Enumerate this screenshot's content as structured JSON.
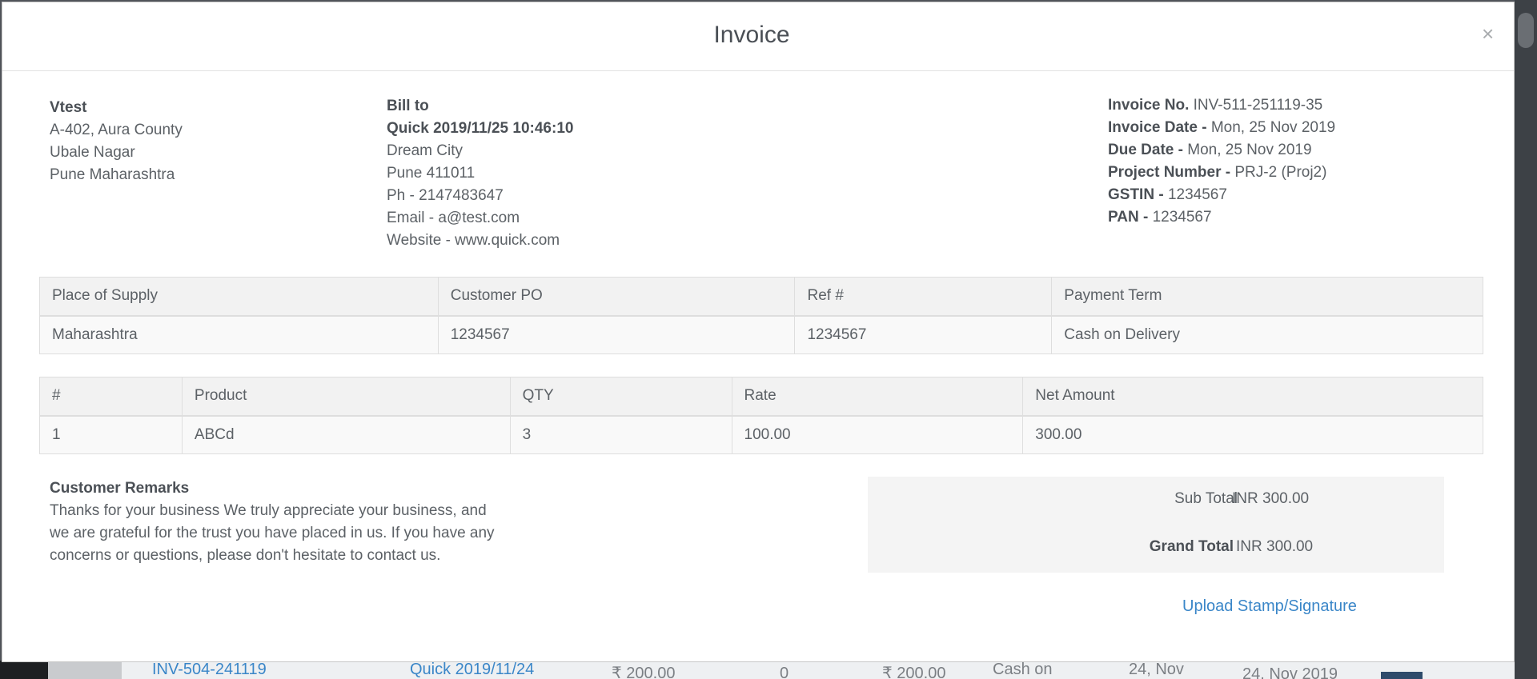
{
  "modal": {
    "title": "Invoice",
    "close": "×"
  },
  "seller": {
    "name": "Vtest",
    "address_lines": [
      "A-402, Aura County",
      "Ubale Nagar",
      "Pune Maharashtra"
    ]
  },
  "bill_to": {
    "heading": "Bill to",
    "customer": "Quick 2019/11/25 10:46:10",
    "lines": [
      "Dream City",
      "Pune 411011",
      "Ph - 2147483647",
      "Email - a@test.com",
      "Website - www.quick.com"
    ]
  },
  "meta": {
    "invoice_no_label": "Invoice No.",
    "invoice_no": "INV-511-251119-35",
    "invoice_date_label": "Invoice Date -",
    "invoice_date": "Mon, 25 Nov 2019",
    "due_date_label": "Due Date -",
    "due_date": "Mon, 25 Nov 2019",
    "project_label": "Project Number -",
    "project": "PRJ-2 (Proj2)",
    "gstin_label": "GSTIN -",
    "gstin": "1234567",
    "pan_label": "PAN -",
    "pan": "1234567"
  },
  "supply_table": {
    "headers": [
      "Place of Supply",
      "Customer PO",
      "Ref #",
      "Payment Term"
    ],
    "row": [
      "Maharashtra",
      "1234567",
      "1234567",
      "Cash on Delivery"
    ]
  },
  "items_table": {
    "headers": [
      "#",
      "Product",
      "QTY",
      "Rate",
      "Net Amount"
    ],
    "rows": [
      [
        "1",
        "ABCd",
        "3",
        "100.00",
        "300.00"
      ]
    ]
  },
  "remarks": {
    "heading": "Customer Remarks",
    "text": "Thanks for your business We truly appreciate your business, and we are grateful for the trust you have placed in us. If you have any concerns or questions, please don't hesitate to contact us."
  },
  "totals": {
    "sub_total_label": "Sub Total",
    "sub_total": "INR 300.00",
    "grand_total_label": "Grand Total",
    "grand_total": "INR 300.00"
  },
  "upload_link": "Upload Stamp/Signature",
  "background_row": {
    "invoice": "INV-504-241119",
    "customer": "Quick 2019/11/24",
    "amount1": "₹ 200.00",
    "qty": "0",
    "amount2": "₹ 200.00",
    "term": "Cash on",
    "date1": "24, Nov",
    "date2": "24, Nov 2019"
  },
  "colors": {
    "link": "#3a86c8",
    "header_bg": "#f2f2f2",
    "row_bg": "#f9f9f9",
    "totals_bg": "#f4f4f4"
  }
}
